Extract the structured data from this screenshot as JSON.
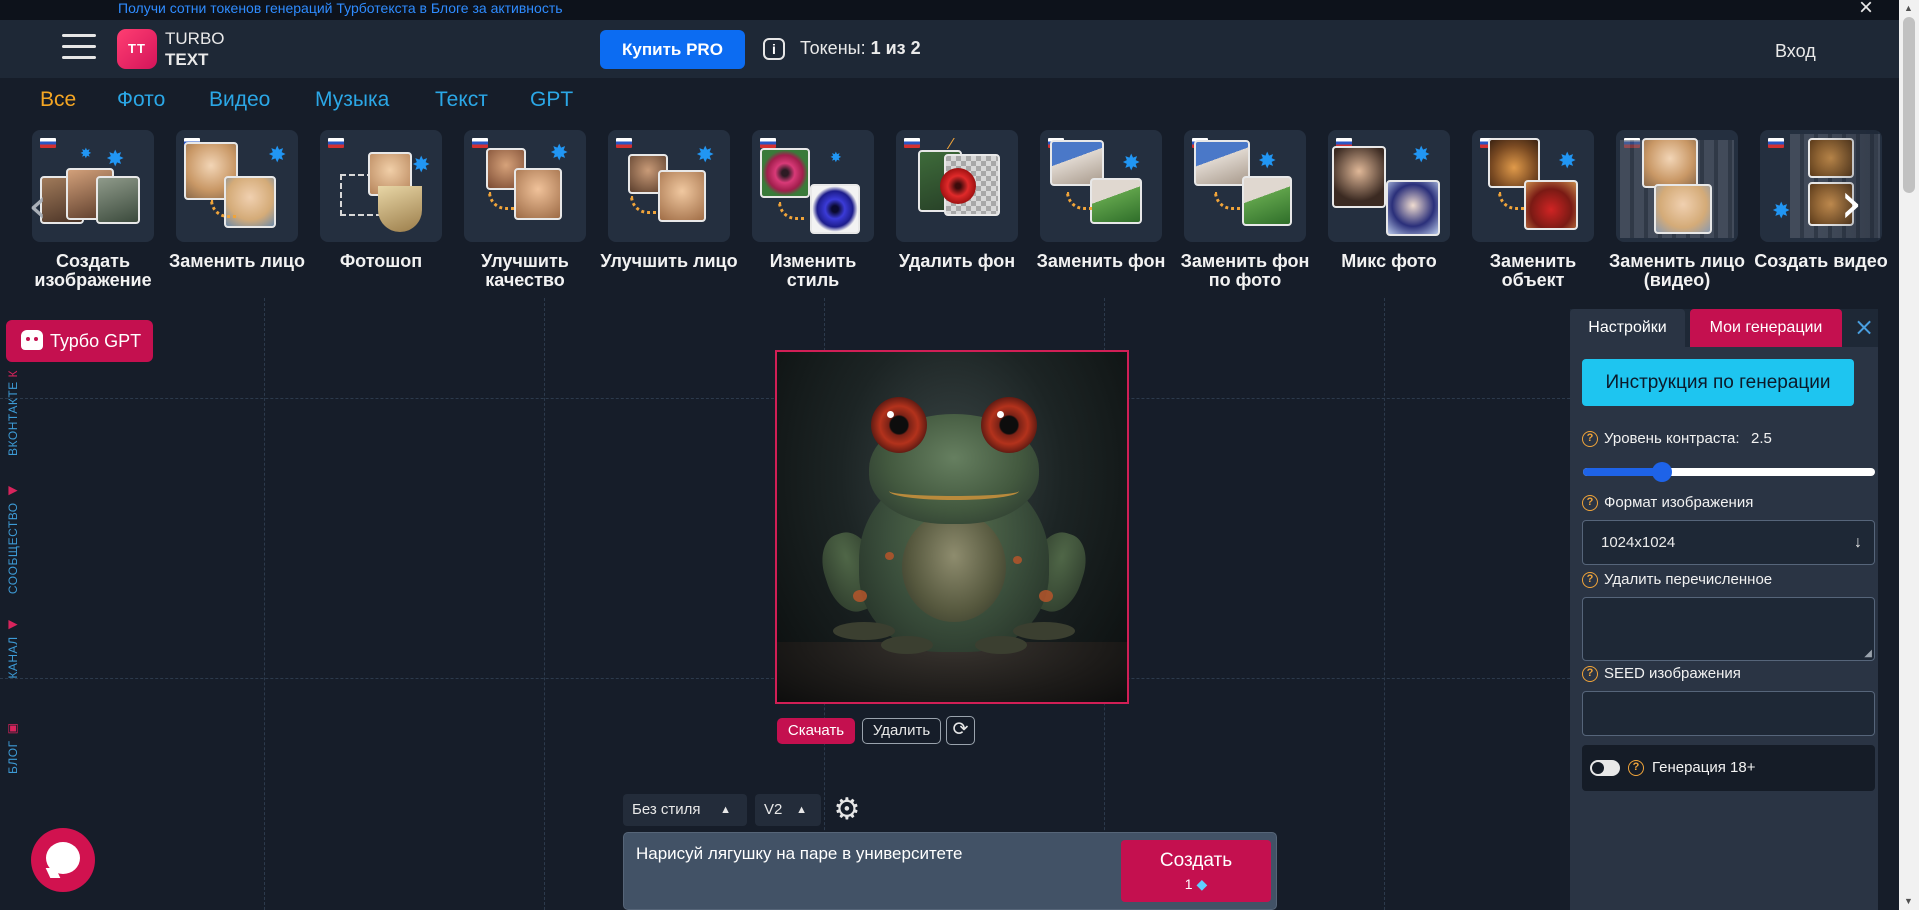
{
  "promo": {
    "text": "Получи сотни токенов генераций Турботекста в Блоге за активность",
    "close_icon": "close-icon"
  },
  "header": {
    "logo_mark": "TT",
    "logo_line1": "TURBO",
    "logo_line2": "TEXT",
    "buy_pro": "Купить PRO",
    "tokens_label": "Токены:",
    "tokens_value": "1 из 2",
    "login": "Вход"
  },
  "nav": {
    "tabs": [
      {
        "label": "Все",
        "active": true
      },
      {
        "label": "Фото"
      },
      {
        "label": "Видео"
      },
      {
        "label": "Музыка"
      },
      {
        "label": "Текст"
      },
      {
        "label": "GPT"
      }
    ],
    "tools": [
      {
        "label": "Создать изображение"
      },
      {
        "label": "Заменить лицо"
      },
      {
        "label": "Фотошоп"
      },
      {
        "label": "Улучшить качество"
      },
      {
        "label": "Улучшить лицо"
      },
      {
        "label": "Изменить стиль"
      },
      {
        "label": "Удалить фон"
      },
      {
        "label": "Заменить фон"
      },
      {
        "label": "Заменить фон по фото"
      },
      {
        "label": "Микс фото"
      },
      {
        "label": "Заменить объект"
      },
      {
        "label": "Заменить лицо (видео)"
      },
      {
        "label": "Создать видео"
      }
    ]
  },
  "sidebar": {
    "turbo_gpt": "Турбо GPT",
    "social": [
      {
        "label": "ВКОНТАКТЕ"
      },
      {
        "label": "СООБЩЕСТВО"
      },
      {
        "label": "КАНАЛ"
      },
      {
        "label": "БЛОГ"
      }
    ]
  },
  "result": {
    "download": "Скачать",
    "delete": "Удалить"
  },
  "composer": {
    "style": "Без стиля",
    "version": "V2",
    "prompt": "Нарисуй лягушку на паре в университете",
    "create_label": "Создать",
    "create_cost": "1"
  },
  "panel": {
    "tab_settings": "Настройки",
    "tab_generations": "Мои генерации",
    "instruction": "Инструкция по генерации",
    "contrast_label": "Уровень контраста:",
    "contrast_value": "2.5",
    "contrast_level": 0.27,
    "format_label": "Формат изображения",
    "format_value": "1024x1024",
    "remove_label": "Удалить перечисленное",
    "seed_label": "SEED изображения",
    "adult_label": "Генерация 18+"
  },
  "colors": {
    "accent_pink": "#c4104f",
    "accent_blue": "#0c6cf2",
    "accent_cyan": "#1ec5f0",
    "tab_active": "#f5a623",
    "tab_link": "#2ba7e6"
  }
}
